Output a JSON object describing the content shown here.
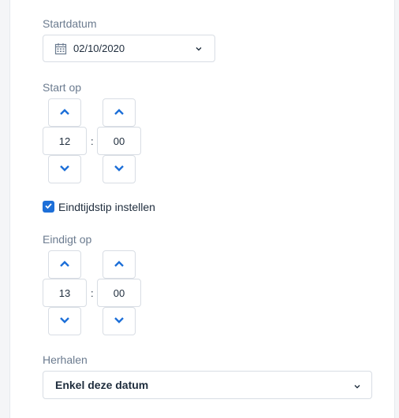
{
  "start_date": {
    "label": "Startdatum",
    "value": "02/10/2020"
  },
  "start_at": {
    "label": "Start op",
    "hours": "12",
    "minutes": "00",
    "separator": ":"
  },
  "set_end_time": {
    "label": "Eindtijdstip instellen",
    "checked": true
  },
  "ends_at": {
    "label": "Eindigt op",
    "hours": "13",
    "minutes": "00",
    "separator": ":"
  },
  "repeat": {
    "label": "Herhalen",
    "value": "Enkel deze datum"
  },
  "colors": {
    "accent": "#1d6fd8",
    "label": "#6b7b8f",
    "text": "#1f2d3d",
    "border": "#d8dde4"
  },
  "icons": {
    "date": "calendar-icon",
    "up": "chevron-up-icon",
    "down": "chevron-down-icon",
    "check": "checkmark-icon"
  }
}
